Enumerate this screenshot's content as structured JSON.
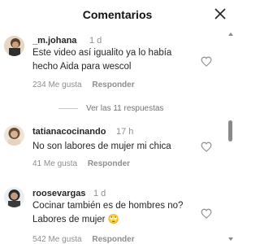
{
  "header": {
    "title": "Comentarios"
  },
  "comments": [
    {
      "username": "_m.johana",
      "time": "1 d",
      "lines": [
        "Este video así igualito ya lo había",
        "hecho Aida para wescol"
      ],
      "likes": "234 Me gusta",
      "reply": "Responder"
    },
    {
      "username": "tatianacocinando",
      "time": "17 h",
      "lines": [
        "No son labores de mujer mi chica"
      ],
      "likes": "41 Me gusta",
      "reply": "Responder"
    },
    {
      "username": "roosevargas",
      "time": "1 d",
      "lines": [
        "Cocinar también es de hombres no?",
        "Labores de mujer"
      ],
      "emoji": "🙄",
      "likes": "542 Me gusta",
      "reply": "Responder"
    }
  ],
  "view_replies": "Ver las 11 respuestas",
  "icons": {
    "close": "close-icon",
    "heart": "heart-outline-icon"
  }
}
